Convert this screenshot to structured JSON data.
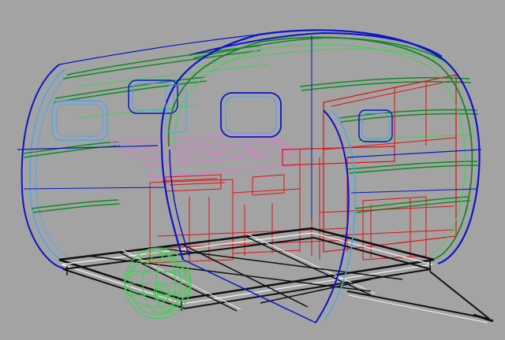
{
  "viewport": {
    "background_color": "#a3a3a3",
    "render_mode": "wireframe",
    "colors": {
      "shell_outline": "#0a16c8",
      "shell_inner": "#4aa6ee",
      "ribs": "#0f8a22",
      "cabinets": "#e01212",
      "bed_platform": "#e86ee0",
      "chassis": "#101010",
      "wheel": "#38d64a"
    }
  }
}
